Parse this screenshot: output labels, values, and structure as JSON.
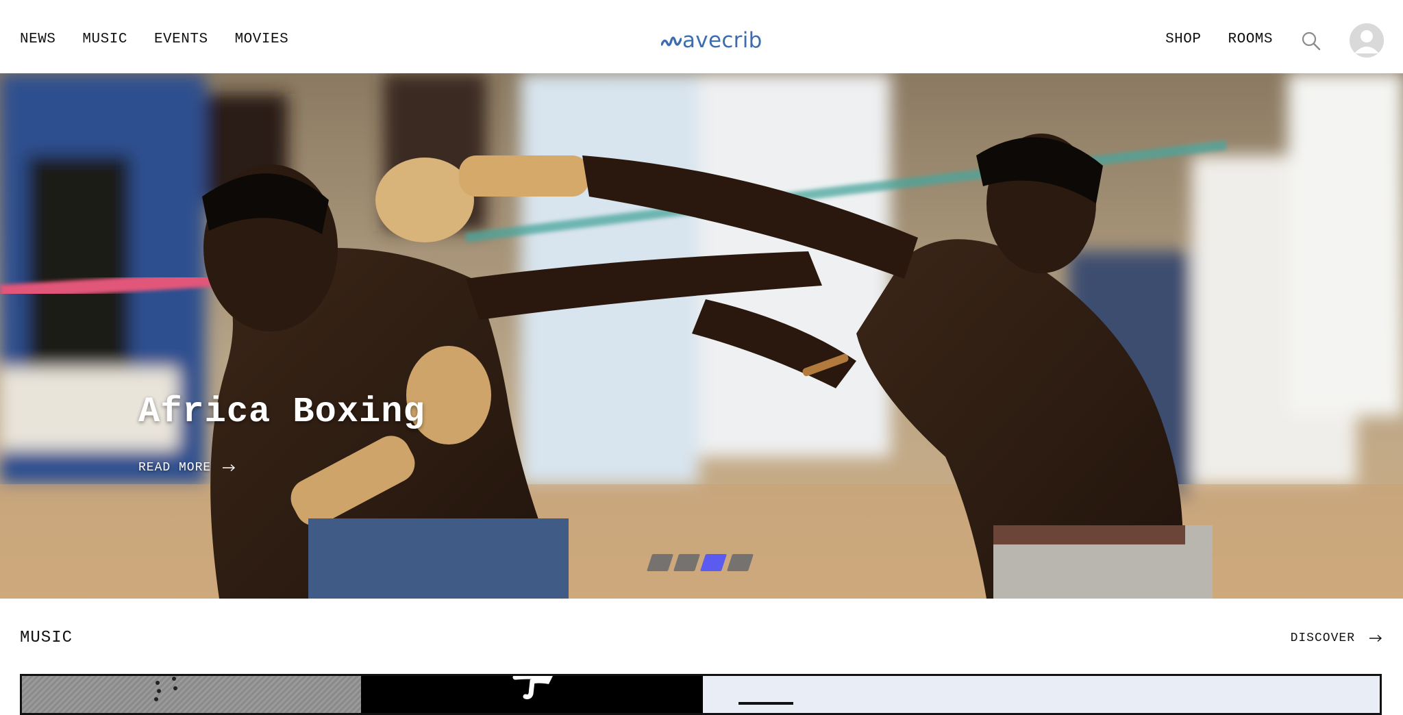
{
  "header": {
    "nav_left": [
      "NEWS",
      "MUSIC",
      "EVENTS",
      "MOVIES"
    ],
    "logo_text": "avecrib",
    "nav_right": [
      "SHOP",
      "ROOMS"
    ],
    "search_icon": "search-icon",
    "avatar_icon": "user-avatar-icon"
  },
  "hero": {
    "title": "Africa Boxing",
    "read_more": "READ MORE",
    "slides": [
      {
        "active": false
      },
      {
        "active": false
      },
      {
        "active": true
      },
      {
        "active": false
      }
    ]
  },
  "music_section": {
    "title": "MUSIC",
    "discover": "DISCOVER"
  },
  "colors": {
    "brand": "#3c6db0",
    "active_dot": "#5b5bf0",
    "inactive_dot": "#6e6e6e",
    "text": "#111111"
  }
}
